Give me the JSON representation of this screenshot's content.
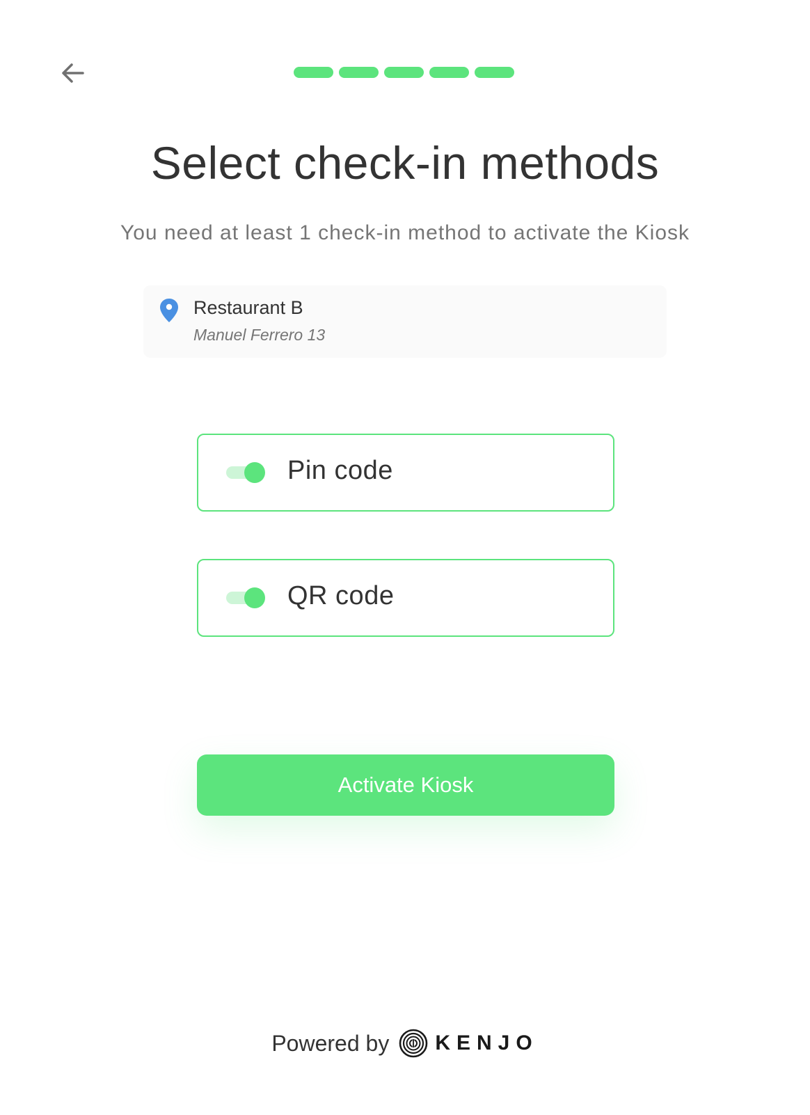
{
  "header": {
    "back_icon": "arrow-left-icon",
    "progress_steps": 5,
    "progress_completed": 5,
    "accent_color": "#5ce47d"
  },
  "title": "Select check-in methods",
  "subtitle": "You need at least 1 check-in method to activate the Kiosk",
  "location": {
    "icon": "map-pin-icon",
    "name": "Restaurant B",
    "address": "Manuel Ferrero 13"
  },
  "methods": [
    {
      "label": "Pin code",
      "enabled": true
    },
    {
      "label": "QR code",
      "enabled": true
    }
  ],
  "activate_button": {
    "label": "Activate Kiosk"
  },
  "footer": {
    "powered_by": "Powered by",
    "brand": "KENJO",
    "brand_icon": "kenjo-logo-icon"
  }
}
